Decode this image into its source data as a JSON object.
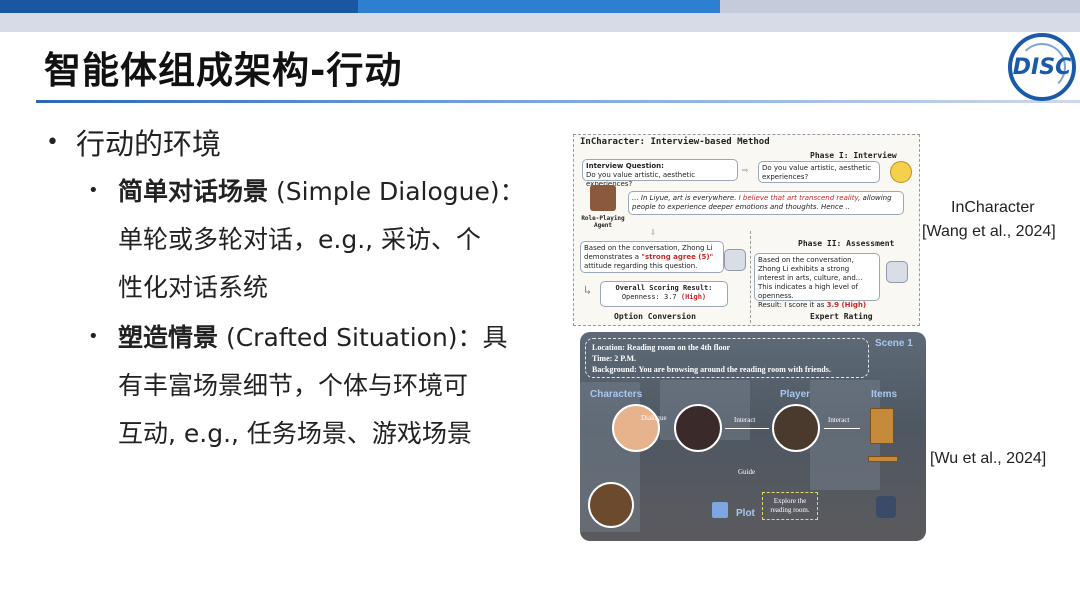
{
  "slide": {
    "title": "智能体组成架构-行动",
    "logo_text": "DISC",
    "bullet_main": "行动的环境",
    "items": [
      {
        "bold": "简单对话场景",
        "rest_line1": " (Simple Dialogue)：",
        "line2": "单轮或多轮对话，e.g., 采访、个",
        "line3": "性化对话系统"
      },
      {
        "bold": "塑造情景",
        "rest_line1": " (Crafted Situation)：具",
        "line2": "有丰富场景细节，个体与环境可",
        "line3": "互动, e.g., 任务场景、游戏场景"
      }
    ],
    "caption1_line1": "InCharacter",
    "caption1_line2": "[Wang et al., 2024]",
    "caption2": "[Wu et al., 2024]"
  },
  "figure1": {
    "title": "InCharacter: Interview-based Method",
    "phase1": "Phase I: Interview",
    "phase2": "Phase II: Assessment",
    "question_label": "Interview Question:",
    "question": "Do you value artistic, aesthetic experiences?",
    "question_repeat": "Do you value artistic, aesthetic experiences?",
    "agent_answer_pre": "... In Liyue, art is everywhere. ",
    "agent_answer_red": "I believe that art transcend reality",
    "agent_answer_post": ", allowing people to experience deeper emotions and thoughts. Hence ..",
    "agent_label": "Role-Playing Agent",
    "option_text_pre": "Based on the conversation, Zhong Li demonstrates a ",
    "option_text_red": "\"strong agree (5)\"",
    "option_text_post": " attitude regarding this question.",
    "overall_label": "Overall Scoring Result:",
    "overall_value_pre": "Openness: 3.7 ",
    "overall_value_red": "(High)",
    "expert_text": "Based on the conversation, Zhong Li exhibits a strong interest in arts, culture, and... This indicates a high level of openness.",
    "expert_result_pre": "Result: I score it as ",
    "expert_result_red": "3.9 (High)",
    "footer_left": "Option Conversion",
    "footer_right": "Expert Rating"
  },
  "figure2": {
    "location": "Location:  Reading room on the 4th floor",
    "time": "Time:  2 P.M.",
    "background": "Background:  You are browsing around the reading room with friends.",
    "scene": "Scene 1",
    "characters": "Characters",
    "player": "Player",
    "items": "Items",
    "dialogue": "Dialogue",
    "interact1": "Interact",
    "interact2": "Interact",
    "guide": "Guide",
    "plot": "Plot",
    "plot_box": "Explore the reading room."
  },
  "colors": {
    "accent_blue": "#1a57a3",
    "highlight_red": "#c9292b",
    "label_blue": "#a9c7f0"
  }
}
